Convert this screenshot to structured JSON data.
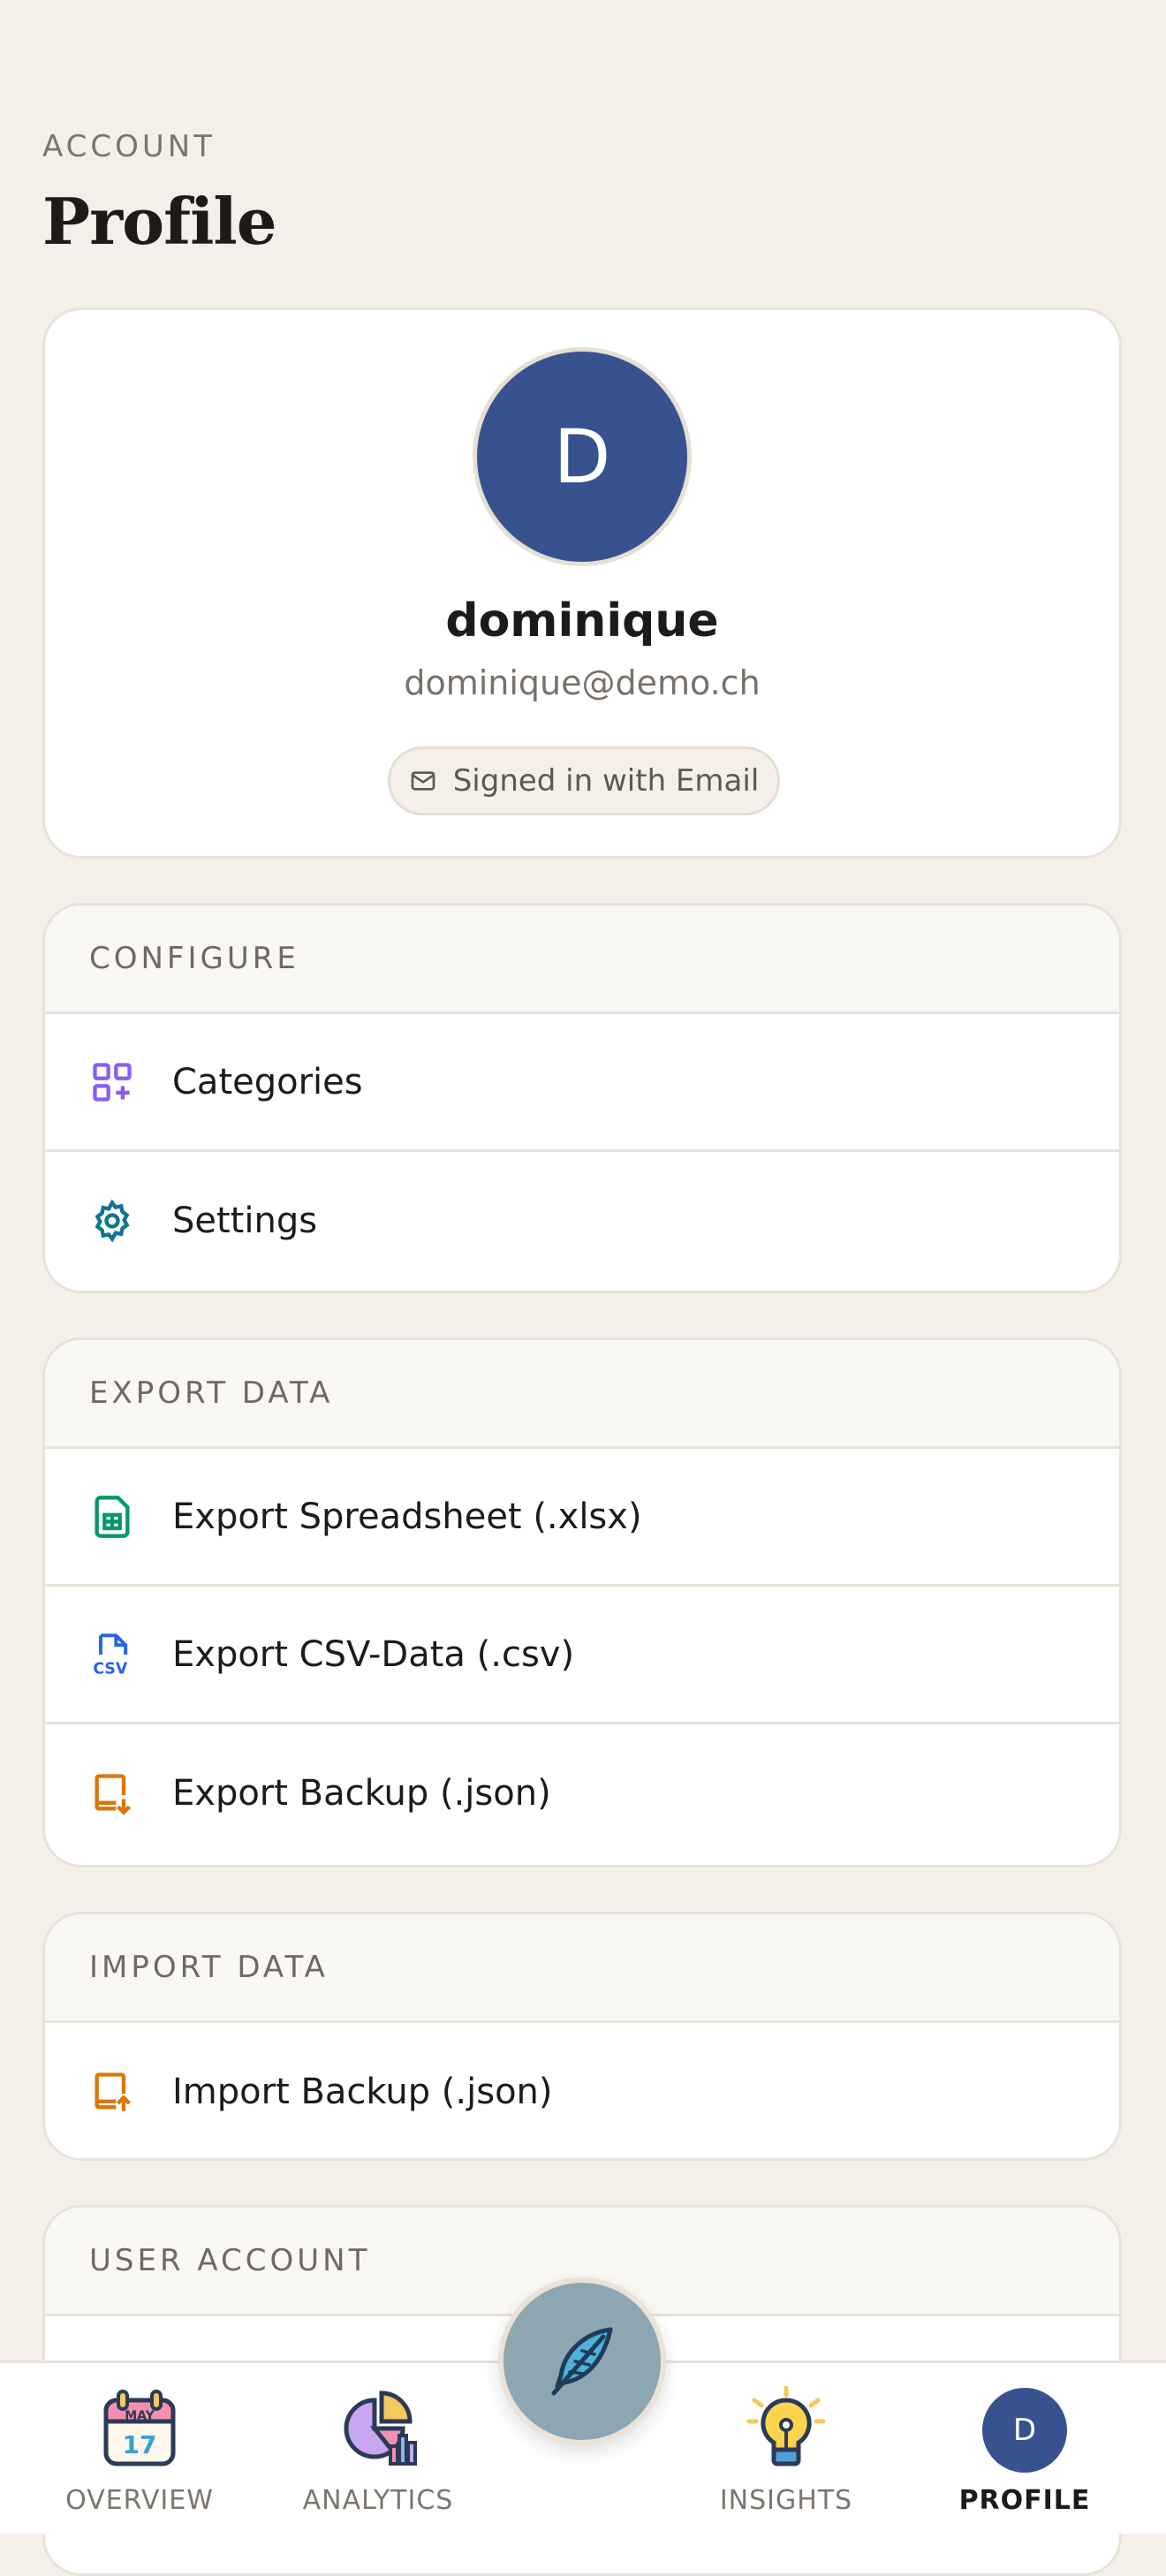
{
  "header": {
    "eyebrow": "ACCOUNT",
    "title": "Profile"
  },
  "profile": {
    "avatar_initial": "D",
    "username": "dominique",
    "email": "dominique@demo.ch",
    "auth_chip": "Signed in with Email",
    "avatar_color": "#37528f"
  },
  "sections": {
    "configure": {
      "title": "CONFIGURE",
      "items": [
        {
          "label": "Categories",
          "icon": "categories-icon"
        },
        {
          "label": "Settings",
          "icon": "gear-icon"
        }
      ]
    },
    "export": {
      "title": "EXPORT DATA",
      "items": [
        {
          "label": "Export Spreadsheet (.xlsx)",
          "icon": "spreadsheet-icon"
        },
        {
          "label": "Export CSV-Data (.csv)",
          "icon": "csv-icon"
        },
        {
          "label": "Export Backup (.json)",
          "icon": "export-backup-icon"
        }
      ]
    },
    "import": {
      "title": "IMPORT DATA",
      "items": [
        {
          "label": "Import Backup (.json)",
          "icon": "import-backup-icon"
        }
      ]
    },
    "user_account": {
      "title": "USER ACCOUNT"
    }
  },
  "tabbar": {
    "tabs": [
      {
        "label": "OVERVIEW",
        "icon": "calendar-icon",
        "calendar_month": "MAY",
        "calendar_day": "17"
      },
      {
        "label": "ANALYTICS",
        "icon": "analytics-icon"
      },
      {
        "label": "INSIGHTS",
        "icon": "lightbulb-icon"
      },
      {
        "label": "PROFILE",
        "icon": "avatar",
        "avatar_initial": "D"
      }
    ],
    "fab_icon": "feather-icon",
    "fab_color": "#8ca7b2"
  }
}
